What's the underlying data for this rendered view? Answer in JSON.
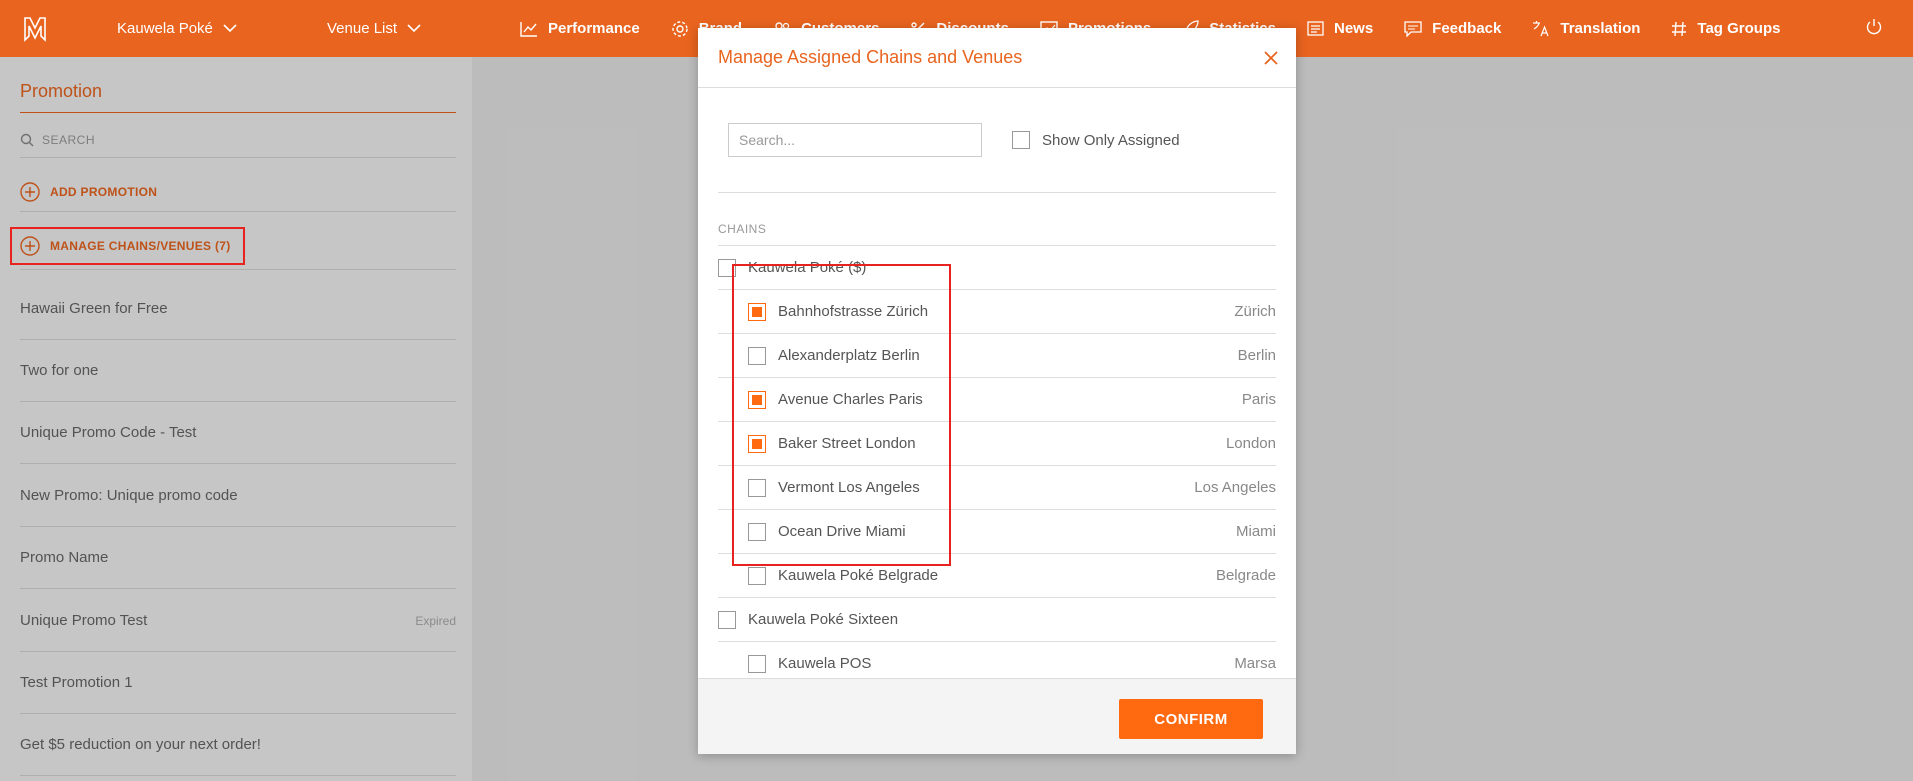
{
  "topbar": {
    "brand_selector": "Kauwela Poké",
    "venue_selector": "Venue List",
    "nav": [
      {
        "label": "Performance",
        "icon": "chart-line-icon"
      },
      {
        "label": "Brand",
        "icon": "gear-icon"
      },
      {
        "label": "Customers",
        "icon": "users-icon"
      },
      {
        "label": "Discounts",
        "icon": "percent-icon"
      },
      {
        "label": "Promotions",
        "icon": "image-icon"
      },
      {
        "label": "Statistics",
        "icon": "rocket-icon"
      },
      {
        "label": "News",
        "icon": "newspaper-icon"
      },
      {
        "label": "Feedback",
        "icon": "chat-icon"
      },
      {
        "label": "Translation",
        "icon": "translate-icon"
      },
      {
        "label": "Tag Groups",
        "icon": "hashtag-icon"
      }
    ]
  },
  "sidebar": {
    "title": "Promotion",
    "search_label": "SEARCH",
    "add_label": "ADD PROMOTION",
    "manage_label": "MANAGE CHAINS/VENUES (7)",
    "promotions": [
      {
        "name": "Hawaii Green for Free",
        "badge": ""
      },
      {
        "name": "Two for one",
        "badge": ""
      },
      {
        "name": "Unique Promo Code - Test",
        "badge": ""
      },
      {
        "name": "New Promo: Unique promo code",
        "badge": ""
      },
      {
        "name": "Promo Name",
        "badge": ""
      },
      {
        "name": "Unique Promo Test",
        "badge": "Expired"
      },
      {
        "name": "Test Promotion 1",
        "badge": ""
      },
      {
        "name": "Get $5 reduction on your next order!",
        "badge": ""
      }
    ]
  },
  "modal": {
    "title": "Manage Assigned Chains and Venues",
    "search_placeholder": "Search...",
    "show_only_assigned": "Show Only Assigned",
    "chains_header": "CHAINS",
    "rows": [
      {
        "type": "chain",
        "name": "Kauwela Poké ($)",
        "checked": false
      },
      {
        "type": "venue",
        "name": "Bahnhofstrasse Zürich",
        "city": "Zürich",
        "checked": true
      },
      {
        "type": "venue",
        "name": "Alexanderplatz Berlin",
        "city": "Berlin",
        "checked": false
      },
      {
        "type": "venue",
        "name": "Avenue Charles Paris",
        "city": "Paris",
        "checked": true
      },
      {
        "type": "venue",
        "name": "Baker Street London",
        "city": "London",
        "checked": true
      },
      {
        "type": "venue",
        "name": "Vermont Los Angeles",
        "city": "Los Angeles",
        "checked": false
      },
      {
        "type": "venue",
        "name": "Ocean Drive Miami",
        "city": "Miami",
        "checked": false
      },
      {
        "type": "venue",
        "name": "Kauwela Poké Belgrade",
        "city": "Belgrade",
        "checked": false
      },
      {
        "type": "chain",
        "name": "Kauwela Poké Sixteen",
        "checked": false
      },
      {
        "type": "venue",
        "name": "Kauwela POS",
        "city": "Marsa",
        "checked": false
      }
    ],
    "confirm_label": "CONFIRM"
  },
  "colors": {
    "accent": "#e8641f",
    "checkbox_on": "#ff6a10",
    "highlight": "#e8231f"
  }
}
